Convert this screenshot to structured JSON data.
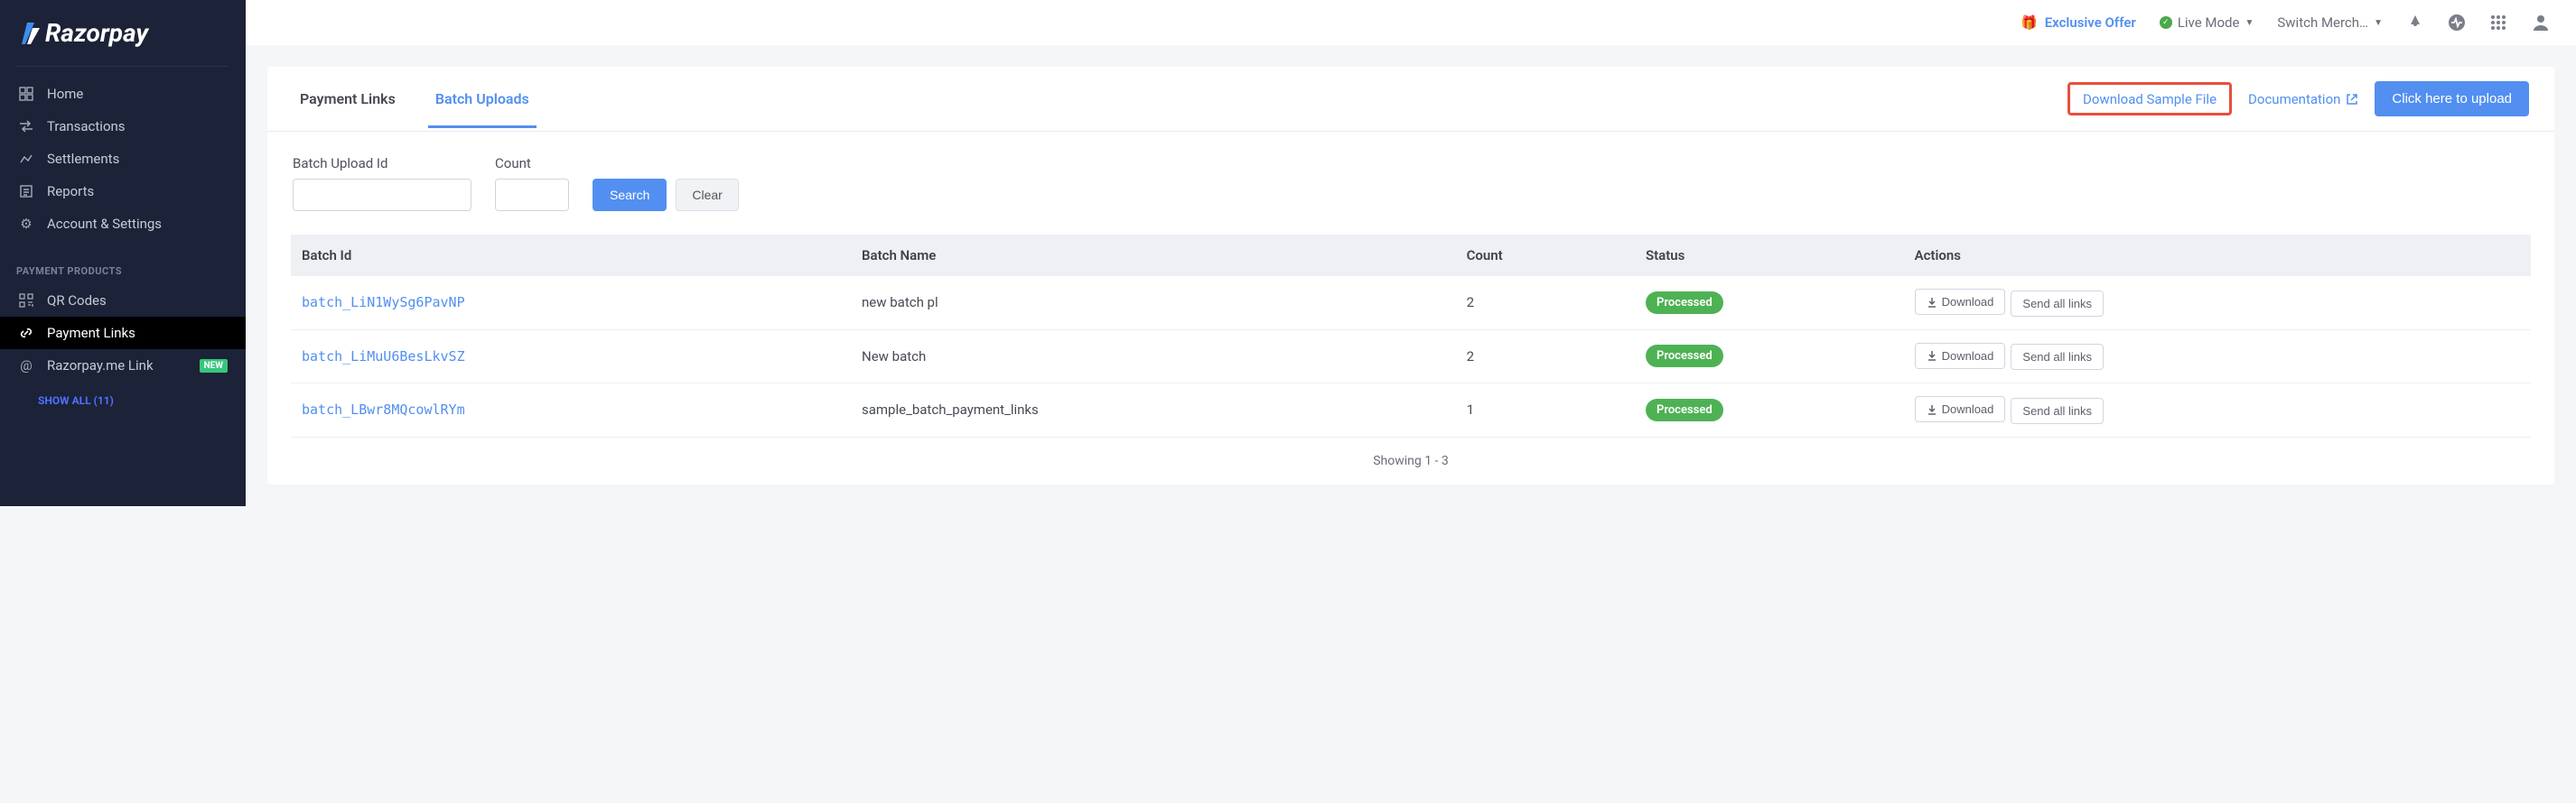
{
  "brand": "Razorpay",
  "sidebar": {
    "items": [
      {
        "label": "Home"
      },
      {
        "label": "Transactions"
      },
      {
        "label": "Settlements"
      },
      {
        "label": "Reports"
      },
      {
        "label": "Account & Settings"
      }
    ],
    "section_title": "PAYMENT PRODUCTS",
    "products": [
      {
        "label": "QR Codes"
      },
      {
        "label": "Payment Links"
      },
      {
        "label": "Razorpay.me Link",
        "badge": "NEW"
      }
    ],
    "show_all": "SHOW ALL (11)"
  },
  "topbar": {
    "offer": "Exclusive Offer",
    "live_mode": "Live Mode",
    "switch": "Switch Merch…"
  },
  "tabs": {
    "payment_links": "Payment Links",
    "batch_uploads": "Batch Uploads"
  },
  "actions": {
    "download_sample": "Download Sample File",
    "documentation": "Documentation",
    "upload": "Click here to upload"
  },
  "filters": {
    "batch_label": "Batch Upload Id",
    "count_label": "Count",
    "search": "Search",
    "clear": "Clear"
  },
  "table": {
    "headers": {
      "batch_id": "Batch Id",
      "batch_name": "Batch Name",
      "count": "Count",
      "status": "Status",
      "actions": "Actions"
    },
    "rows": [
      {
        "id": "batch_LiN1WySg6PavNP",
        "name": "new batch pl",
        "count": "2",
        "status": "Processed"
      },
      {
        "id": "batch_LiMuU6BesLkvSZ",
        "name": "New batch",
        "count": "2",
        "status": "Processed"
      },
      {
        "id": "batch_LBwr8MQcowlRYm",
        "name": "sample_batch_payment_links",
        "count": "1",
        "status": "Processed"
      }
    ],
    "download_label": "Download",
    "send_all_label": "Send all links"
  },
  "showing": "Showing 1 - 3"
}
